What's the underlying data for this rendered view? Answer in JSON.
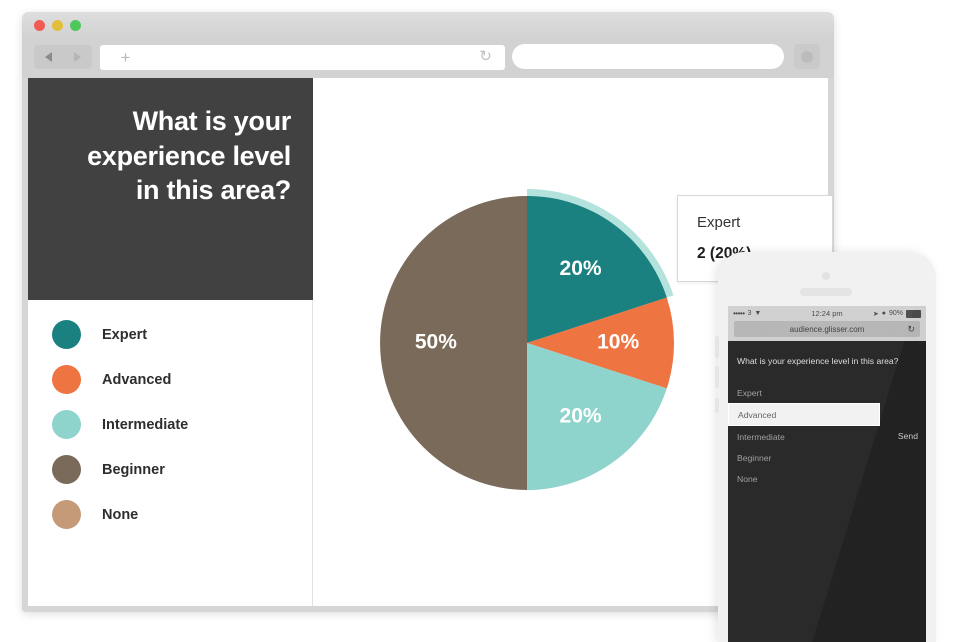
{
  "browser": {
    "traffic_lights": [
      "close",
      "minimize",
      "maximize"
    ],
    "back_label": "Back",
    "forward_label": "Forward",
    "new_tab_label": "+",
    "reload_label": "↻",
    "search_placeholder": "",
    "search_value": "",
    "profile_label": "Profile"
  },
  "slide": {
    "question": "What is your experience level in this area?"
  },
  "legend": {
    "items": [
      {
        "label": "Expert",
        "color": "#1a8080"
      },
      {
        "label": "Advanced",
        "color": "#ee7442"
      },
      {
        "label": "Intermediate",
        "color": "#8fd4cc"
      },
      {
        "label": "Beginner",
        "color": "#7a6a59"
      },
      {
        "label": "None",
        "color": "#c49a78"
      }
    ]
  },
  "tooltip": {
    "title": "Expert",
    "value": "2 (20%)"
  },
  "phone": {
    "status": {
      "carrier_dots": "•••••",
      "carrier_name": "3",
      "wifi": "▼",
      "time": "12:24 pm",
      "location": "➤",
      "alarm": "●",
      "battery_percent": "90%"
    },
    "url": "audience.glisser.com",
    "reload": "↻",
    "question": "What is your experience level in this area?",
    "options": [
      {
        "label": "Expert",
        "selected": false
      },
      {
        "label": "Advanced",
        "selected": true
      },
      {
        "label": "Intermediate",
        "selected": false
      },
      {
        "label": "Beginner",
        "selected": false
      },
      {
        "label": "None",
        "selected": false
      }
    ],
    "send_label": "Send"
  },
  "chart_data": {
    "type": "pie",
    "title": "What is your experience level in this area?",
    "categories": [
      "Expert",
      "Advanced",
      "Intermediate",
      "Beginner",
      "None"
    ],
    "values": [
      20,
      10,
      20,
      50,
      0
    ],
    "counts": [
      2,
      1,
      2,
      5,
      0
    ],
    "data_labels": [
      "20%",
      "10%",
      "20%",
      "50%",
      ""
    ],
    "colors": [
      "#1a8080",
      "#ee7442",
      "#8fd4cc",
      "#7a6a59",
      "#c49a78"
    ],
    "legend_position": "left",
    "start_angle_deg": 0,
    "direction": "clockwise",
    "highlighted_slice": "Expert",
    "highlight_color": "#b4e2dc",
    "ylabel": "",
    "xlabel": ""
  }
}
